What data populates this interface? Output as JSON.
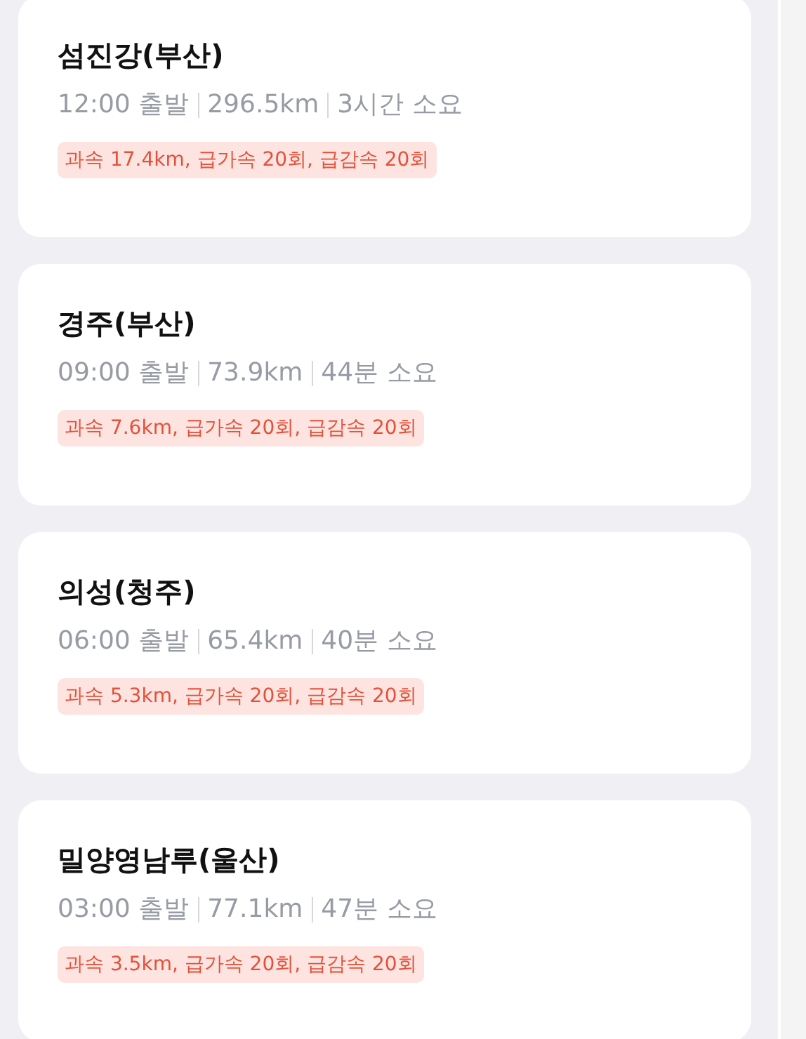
{
  "trips": [
    {
      "title": "섬진강(부산)",
      "depart": "12:00 출발",
      "distance": "296.5km",
      "duration": "3시간 소요",
      "warning": "과속 17.4km, 급가속 20회, 급감속 20회"
    },
    {
      "title": "경주(부산)",
      "depart": "09:00 출발",
      "distance": "73.9km",
      "duration": "44분 소요",
      "warning": "과속 7.6km, 급가속 20회, 급감속 20회"
    },
    {
      "title": "의성(청주)",
      "depart": "06:00 출발",
      "distance": "65.4km",
      "duration": "40분 소요",
      "warning": "과속 5.3km, 급가속 20회, 급감속 20회"
    },
    {
      "title": "밀양영남루(울산)",
      "depart": "03:00 출발",
      "distance": "77.1km",
      "duration": "47분 소요",
      "warning": "과속 3.5km, 급가속 20회, 급감속 20회"
    }
  ]
}
